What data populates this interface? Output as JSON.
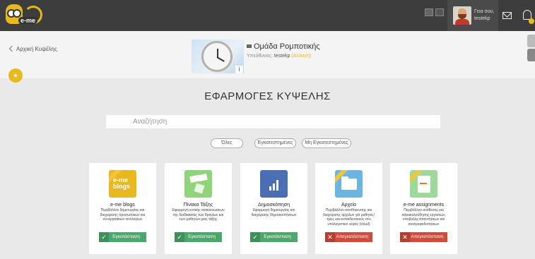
{
  "topbar": {
    "logo_text": "e-me",
    "greeting_line1": "Γεια σου,",
    "greeting_line2": "testekp"
  },
  "header": {
    "back_label": "Αρχική Κυψέλης",
    "group_name": "Ομάδα Ρομποτικής",
    "owner_prefix": "Υπεύθυνος:",
    "owner_name": "testekp",
    "owner_change": "(Αλλαγή)",
    "info_icon_text": "i"
  },
  "main": {
    "title": "ΕΦΑΡΜΟΓΕΣ ΚΥΨΕΛΗΣ",
    "search_placeholder": "Αναζήτηση",
    "filters": [
      "Όλες",
      "Εγκατεστημένες",
      "Μη Εγκατεστημένες"
    ]
  },
  "apps": [
    {
      "name": "e-me blogs",
      "description": "Περιβάλλον δημιουργίας και διαχείρισης προσωπικών και συνεργατικών ιστολογίων",
      "action": "Εγκατάσταση",
      "status": "installed",
      "icon": "blogs-icon",
      "icon_text": "e-me blogs"
    },
    {
      "name": "Πίνακα Τάξης",
      "description": "Εφαρμογή εντικής ανακοινώσεων της διαδικασίας των θρανίων και των μαθητών μιας τάξης",
      "action": "Εγκατάσταση",
      "status": "installed",
      "icon": "class-board-icon"
    },
    {
      "name": "Δημοσκόπηση",
      "description": "Εφαρμογή δημιουργίας και διαχείρισης δημοσκοπήσεων",
      "action": "Εγκατάσταση",
      "status": "installed",
      "icon": "poll-icon"
    },
    {
      "name": "Αρχεία",
      "description": "Περιβάλλον αποθήκευσης και διαχείρισης αρχείων για μαθητές/τριες και εκπαιδευτικούς στο υπολογιστικό νέφος (cloud)",
      "action": "Απεγκατάσταση",
      "status": "removable",
      "icon": "files-icon"
    },
    {
      "name": "e-me assignments",
      "description": "Περιβάλλον ανάθεσης και παρακολούθησης εργασιών, υποβολής απαντήσεων και ανατροφοδοτήσεων",
      "action": "Απεγκατάσταση",
      "status": "removable",
      "icon": "assignments-icon"
    }
  ],
  "colors": {
    "topbar": "#3d3d3d",
    "accent": "#e8b81c",
    "install": "#4aa86a",
    "remove": "#d44a3a",
    "background": "#e9e9e9"
  }
}
